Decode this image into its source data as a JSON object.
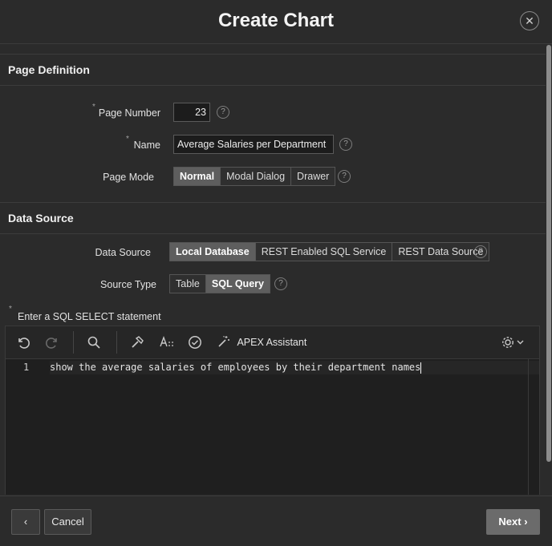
{
  "dialog": {
    "title": "Create Chart",
    "close_symbol": "✕"
  },
  "page_definition": {
    "heading": "Page Definition",
    "page_number": {
      "label": "Page Number",
      "value": "23"
    },
    "name": {
      "label": "Name",
      "value": "Average Salaries per Department"
    },
    "page_mode": {
      "label": "Page Mode",
      "options": [
        "Normal",
        "Modal Dialog",
        "Drawer"
      ],
      "selected": "Normal"
    }
  },
  "data_source": {
    "heading": "Data Source",
    "source": {
      "label": "Data Source",
      "options": [
        "Local Database",
        "REST Enabled SQL Service",
        "REST Data Source"
      ],
      "selected": "Local Database"
    },
    "source_type": {
      "label": "Source Type",
      "options": [
        "Table",
        "SQL Query"
      ],
      "selected": "SQL Query"
    },
    "sql_label": "Enter a SQL SELECT statement"
  },
  "editor": {
    "toolbar": {
      "apex_assistant": "APEX Assistant"
    },
    "lines": [
      {
        "number": "1",
        "text": "show the average salaries of employees by their department names"
      }
    ]
  },
  "required_marker": "*",
  "help_symbol": "?",
  "footer": {
    "back_symbol": "‹",
    "cancel": "Cancel",
    "next": "Next",
    "next_symbol": "›"
  },
  "colors": {
    "background": "#2b2b2b",
    "primary_button": "#6b6b6b",
    "selected_segment": "#5e5e5e"
  }
}
